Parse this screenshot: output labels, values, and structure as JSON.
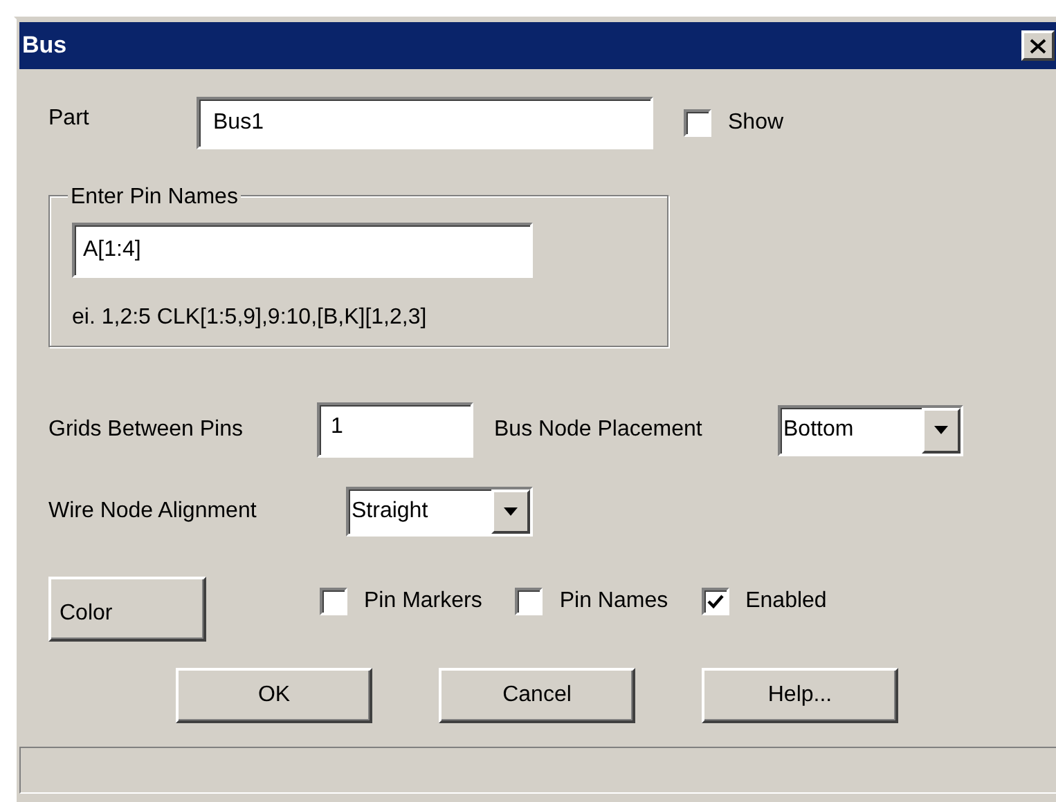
{
  "window": {
    "title": "Bus"
  },
  "part": {
    "label": "Part",
    "value": "Bus1"
  },
  "show": {
    "label": "Show",
    "checked": false
  },
  "pin_names_group": {
    "title": "Enter Pin Names",
    "value": "A[1:4]",
    "hint": "ei. 1,2:5 CLK[1:5,9],9:10,[B,K][1,2,3]"
  },
  "grids_between_pins": {
    "label": "Grids Between Pins",
    "value": "1"
  },
  "bus_node_placement": {
    "label": "Bus Node Placement",
    "value": "Bottom"
  },
  "wire_node_alignment": {
    "label": "Wire Node Alignment",
    "value": "Straight"
  },
  "color_button": "Color",
  "checkboxes": [
    {
      "label": "Pin Markers",
      "checked": false
    },
    {
      "label": "Pin Names",
      "checked": false
    },
    {
      "label": "Enabled",
      "checked": true
    }
  ],
  "buttons": [
    "OK",
    "Cancel",
    "Help..."
  ]
}
